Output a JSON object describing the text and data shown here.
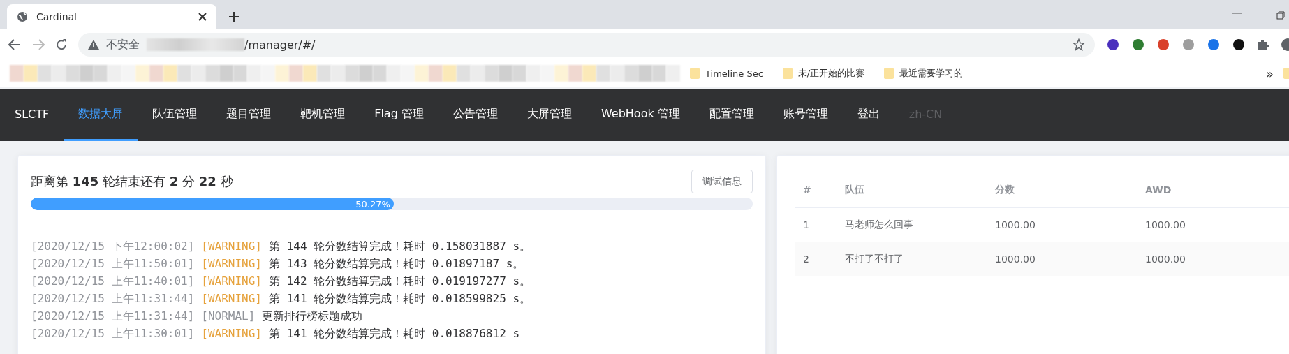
{
  "browser": {
    "tab_title": "Cardinal",
    "security_label": "不安全",
    "url_path": "/manager/#/",
    "bookmarks": [
      {
        "label": "Timeline Sec"
      },
      {
        "label": "未/正开始的比赛"
      },
      {
        "label": "最近需要学习的"
      }
    ],
    "overflow": "»"
  },
  "nav": {
    "brand": "SLCTF",
    "items": [
      {
        "label": "数据大屏",
        "selected": true
      },
      {
        "label": "队伍管理",
        "selected": false
      },
      {
        "label": "题目管理",
        "selected": false
      },
      {
        "label": "靶机管理",
        "selected": false
      },
      {
        "label": "Flag 管理",
        "selected": false
      },
      {
        "label": "公告管理",
        "selected": false
      },
      {
        "label": "大屏管理",
        "selected": false
      },
      {
        "label": "WebHook 管理",
        "selected": false
      },
      {
        "label": "配置管理",
        "selected": false
      },
      {
        "label": "账号管理",
        "selected": false
      },
      {
        "label": "登出",
        "selected": false
      }
    ],
    "language": "zh-CN"
  },
  "round": {
    "title": "距离第 **145** 轮结束还有 **2** 分 **22** 秒",
    "debug_button": "调试信息",
    "level": 0.5027,
    "percent": "50.27%"
  },
  "logs": [
    {
      "time": "[2020/12/15 下午12:00:02]",
      "kind": "warning",
      "tag": "[WARNING]",
      "message": "第 144 轮分数结算完成！耗时 0.158031887 s。"
    },
    {
      "time": "[2020/12/15 上午11:50:01]",
      "kind": "warning",
      "tag": "[WARNING]",
      "message": "第 143 轮分数结算完成！耗时 0.01897187 s。"
    },
    {
      "time": "[2020/12/15 上午11:40:01]",
      "kind": "warning",
      "tag": "[WARNING]",
      "message": "第 142 轮分数结算完成！耗时 0.019197277 s。"
    },
    {
      "time": "[2020/12/15 上午11:31:44]",
      "kind": "warning",
      "tag": "[WARNING]",
      "message": "第 141 轮分数结算完成！耗时 0.018599825 s。"
    },
    {
      "time": "[2020/12/15 上午11:31:44]",
      "kind": "normal",
      "tag": "[NORMAL]",
      "message": "更新排行榜标题成功"
    },
    {
      "time": "[2020/12/15 上午11:30:01]",
      "kind": "warning",
      "tag": "[WARNING]",
      "message": "第 141 轮分数结算完成！耗时 0.018876812 s"
    }
  ],
  "ranking": {
    "columns": [
      "#",
      "队伍",
      "分数",
      "AWD"
    ],
    "rows": [
      {
        "cells": [
          "1",
          "马老师怎么回事",
          "1000.00",
          "1000.00"
        ]
      },
      {
        "cells": [
          "2",
          "不打了不打了",
          "1000.00",
          "1000.00"
        ]
      }
    ]
  }
}
